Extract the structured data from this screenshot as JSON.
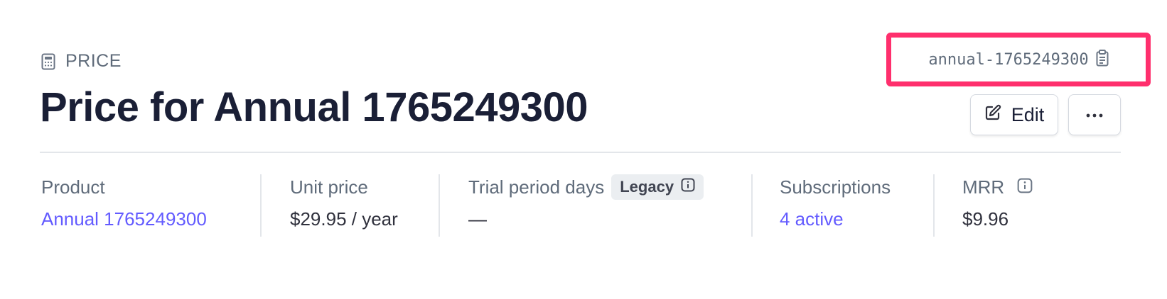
{
  "header": {
    "eyebrow_label": "PRICE",
    "eyebrow_icon": "calculator-icon",
    "title": "Price for Annual 1765249300",
    "price_id": "annual-1765249300",
    "copy_icon": "clipboard-icon",
    "highlight_color": "#ff2f6d"
  },
  "actions": {
    "edit_label": "Edit",
    "edit_icon": "pencil-square-icon",
    "more_icon": "ellipsis-icon"
  },
  "stats": {
    "product": {
      "label": "Product",
      "value": "Annual 1765249300"
    },
    "unit_price": {
      "label": "Unit price",
      "value": "$29.95 / year"
    },
    "trial": {
      "label": "Trial period days",
      "badge": "Legacy",
      "badge_icon": "info-icon",
      "value": "—"
    },
    "subscriptions": {
      "label": "Subscriptions",
      "value": "4 active"
    },
    "mrr": {
      "label": "MRR",
      "info_icon": "info-icon",
      "value": "$9.96"
    }
  },
  "colors": {
    "link": "#635bff",
    "muted": "#5f6b7a",
    "text": "#1a1f36"
  }
}
